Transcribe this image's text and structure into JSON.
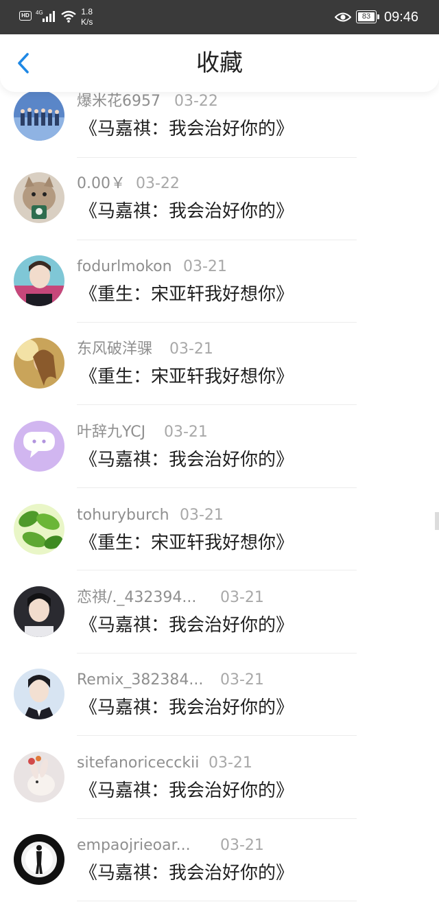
{
  "status_bar": {
    "hd": "HD",
    "network": "4G",
    "speed_value": "1.8",
    "speed_unit": "K/s",
    "battery": "83",
    "time": "09:46"
  },
  "header": {
    "title": "收藏",
    "back_icon": "chevron-left-icon",
    "accent_color": "#1e88e5"
  },
  "favorites": [
    {
      "user": "爆米花6957",
      "date": "03-22",
      "title": "《马嘉祺：我会治好你的》",
      "avatar": "group-photo"
    },
    {
      "user": "0.00￥",
      "date": "03-22",
      "title": "《马嘉祺：我会治好你的》",
      "avatar": "cat-photo"
    },
    {
      "user": "fodurlmokon",
      "date": "03-21",
      "title": "《重生：宋亚轩我好想你》",
      "avatar": "portrait-photo"
    },
    {
      "user": "东风破洋骒",
      "date": "03-21",
      "title": "《重生：宋亚轩我好想你》",
      "avatar": "golden-portrait-photo"
    },
    {
      "user": "叶辞九YCJ",
      "date": "03-21",
      "title": "《马嘉祺：我会治好你的》",
      "avatar": "chat-bubble-icon"
    },
    {
      "user": "tohuryburch",
      "date": "03-21",
      "title": "《重生：宋亚轩我好想你》",
      "avatar": "leaves-photo"
    },
    {
      "user": "恋祺/._432394...",
      "date": "03-21",
      "title": "《马嘉祺：我会治好你的》",
      "avatar": "dark-portrait-photo"
    },
    {
      "user": "Remix_382384...",
      "date": "03-21",
      "title": "《马嘉祺：我会治好你的》",
      "avatar": "suit-portrait-photo"
    },
    {
      "user": "sitefanoricecckii",
      "date": "03-21",
      "title": "《马嘉祺：我会治好你的》",
      "avatar": "rabbit-photo"
    },
    {
      "user": "empaojrieoar...",
      "date": "03-21",
      "title": "《马嘉祺：我会治好你的》",
      "avatar": "silhouette-photo"
    }
  ]
}
